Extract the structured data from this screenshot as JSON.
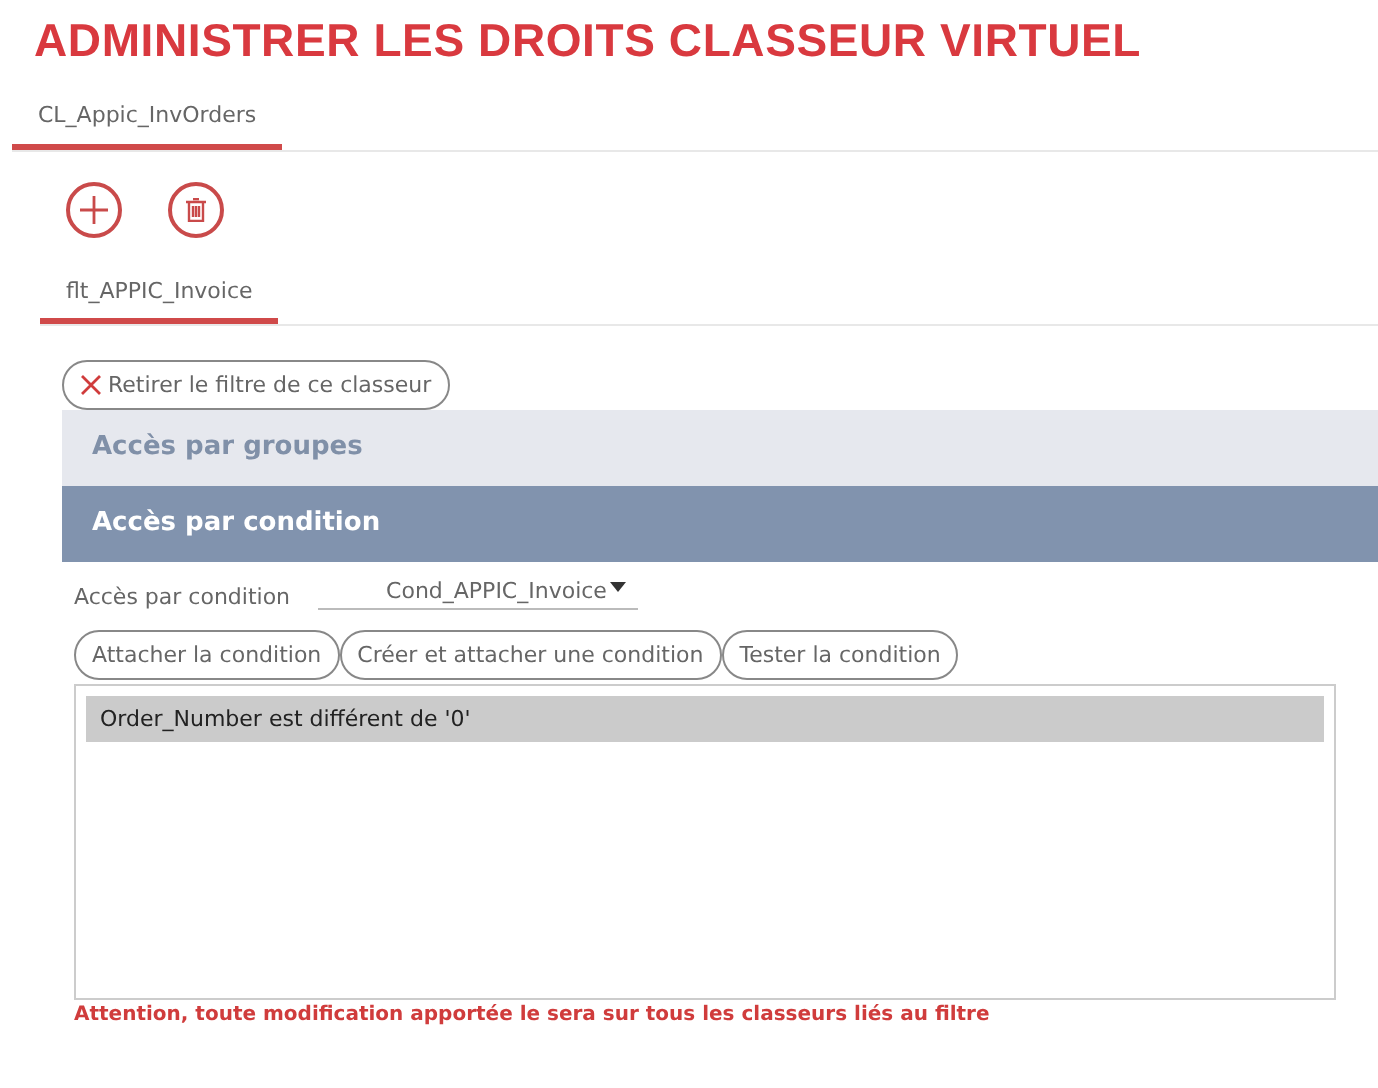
{
  "title": "ADMINISTRER LES DROITS CLASSEUR VIRTUEL",
  "tabs": [
    {
      "label": "CL_Appic_InvOrders",
      "selected": true
    }
  ],
  "toolbar": [
    {
      "kind": "add"
    },
    {
      "kind": "delete"
    }
  ],
  "filter_tabs": [
    {
      "label": "flt_APPIC_Invoice",
      "selected": true
    }
  ],
  "remove_filter_button": "Retirer le filtre de ce classeur",
  "sections": [
    {
      "title": "Accès par groupes",
      "expanded": false
    },
    {
      "title": "Accès par condition",
      "expanded": true
    }
  ],
  "condition_field": {
    "label": "Accès par condition",
    "value": "Cond_APPIC_Invoice"
  },
  "buttons": [
    "Attacher la condition",
    "Créer et attacher une condition",
    "Tester la condition"
  ],
  "conditions": [
    {
      "text": "Order_Number est différent de '0'",
      "selected": true
    }
  ],
  "warning": "Attention, toute modification apportée le sera sur tous les classeurs liés au filtre"
}
